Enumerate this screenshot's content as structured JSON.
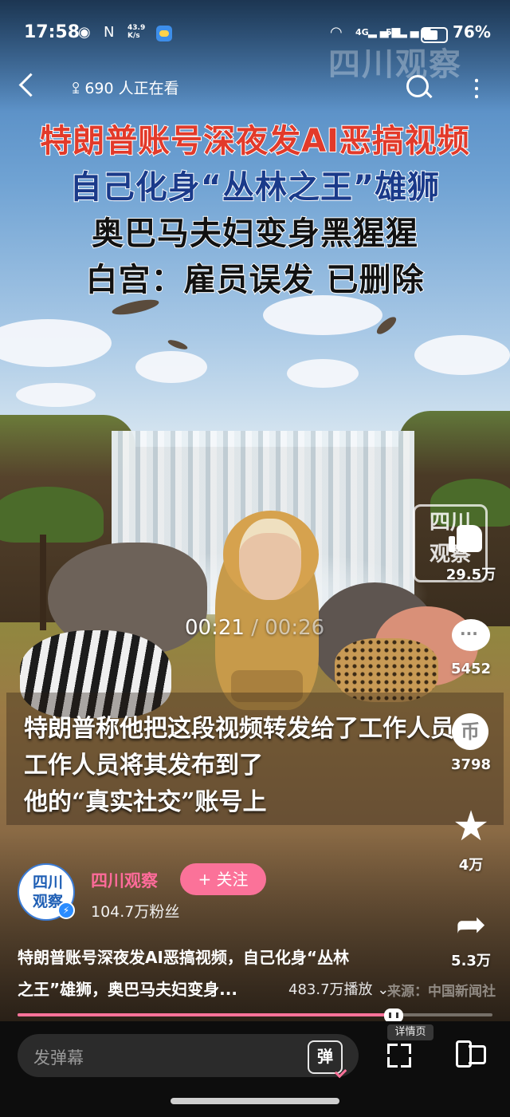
{
  "status_bar": {
    "time": "17:58",
    "net_speed_top": "43.9",
    "net_speed_bottom": "K/s",
    "signal_1": "4G",
    "signal_2": "5G",
    "battery_pct": "76%",
    "battery_level": 0.76,
    "watermark": "四川观察"
  },
  "nav": {
    "viewers": "690 人正在看"
  },
  "headline": {
    "line1": "特朗普账号深夜发AI恶搞视频",
    "line2": "自己化身“丛林之王”雄狮",
    "line3": "奥巴马夫妇变身黑猩猩",
    "line4": "白宫：雇员误发 已删除"
  },
  "player": {
    "current_time": "00:21",
    "separator": " / ",
    "duration": "00:26",
    "logo_line1": "四川",
    "logo_line2": "观察",
    "progress": 0.81
  },
  "subtitles": {
    "line1": "特朗普称他把这段视频转发给了工作人员",
    "line2": "工作人员将其发布到了",
    "line3": "他的“真实社交”账号上"
  },
  "rail": {
    "like_count": "29.5万",
    "comment_count": "5452",
    "coin_count": "3798",
    "favorite_count": "4万",
    "share_count": "5.3万",
    "coin_glyph": "币"
  },
  "author": {
    "avatar_text": "四川观察",
    "name": "四川观察",
    "follow_label": "+ 关注",
    "fans": "104.7万粉丝"
  },
  "video_title": {
    "line1": "特朗普账号深夜发AI恶搞视频，自己化身“丛林",
    "line2": "之王”雄狮，奥巴马夫妇变身...",
    "plays": "483.7万播放",
    "source": "来源：中国新闻社"
  },
  "detail_pill": "详情页",
  "bottom": {
    "danmu_placeholder": "发弹幕",
    "danmu_button": "弹"
  },
  "colors": {
    "accent": "#fb7299",
    "headline_red": "#e23a2a",
    "headline_blue": "#1a3a8a"
  }
}
